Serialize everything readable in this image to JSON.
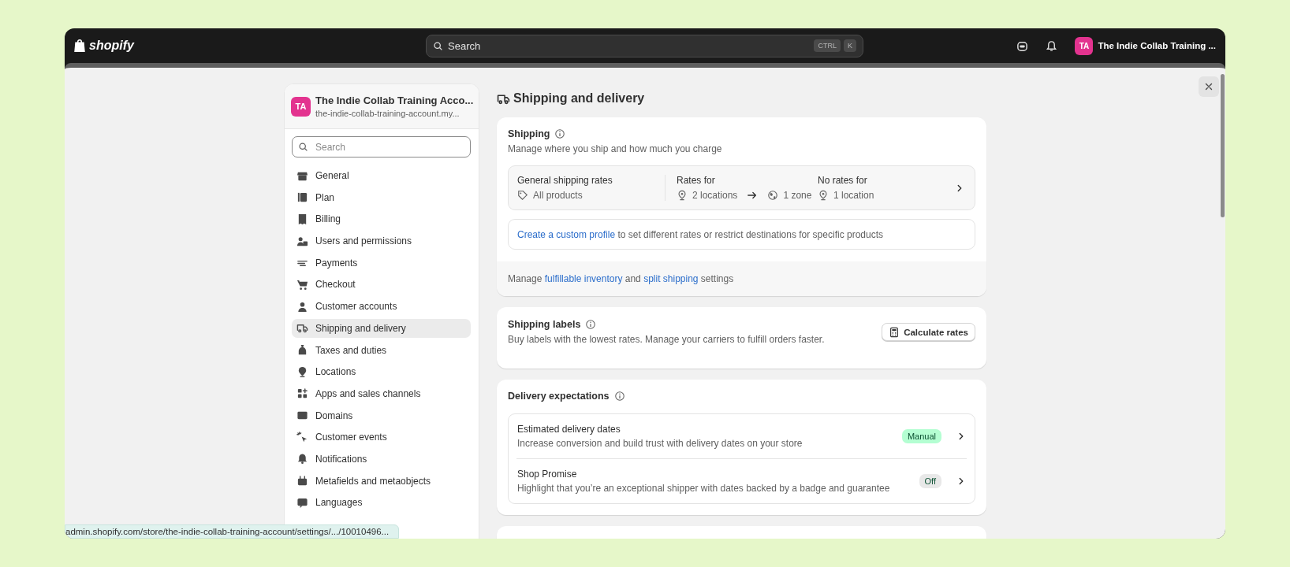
{
  "topbar": {
    "logo": "shopify",
    "search": {
      "placeholder": "Search",
      "shortcut": [
        "CTRL",
        "K"
      ]
    },
    "store": {
      "initials": "TA",
      "name": "The Indie Collab Training ..."
    }
  },
  "sidebar": {
    "store": {
      "initials": "TA",
      "name": "The Indie Collab Training Acco...",
      "domain": "the-indie-collab-training-account.my..."
    },
    "search": {
      "placeholder": "Search"
    },
    "items": [
      {
        "label": "General",
        "selected": false
      },
      {
        "label": "Plan",
        "selected": false
      },
      {
        "label": "Billing",
        "selected": false
      },
      {
        "label": "Users and permissions",
        "selected": false
      },
      {
        "label": "Payments",
        "selected": false
      },
      {
        "label": "Checkout",
        "selected": false
      },
      {
        "label": "Customer accounts",
        "selected": false
      },
      {
        "label": "Shipping and delivery",
        "selected": true
      },
      {
        "label": "Taxes and duties",
        "selected": false
      },
      {
        "label": "Locations",
        "selected": false
      },
      {
        "label": "Apps and sales channels",
        "selected": false
      },
      {
        "label": "Domains",
        "selected": false
      },
      {
        "label": "Customer events",
        "selected": false
      },
      {
        "label": "Notifications",
        "selected": false
      },
      {
        "label": "Metafields and metaobjects",
        "selected": false
      },
      {
        "label": "Languages",
        "selected": false
      }
    ]
  },
  "page": {
    "title": "Shipping and delivery"
  },
  "shipping": {
    "title": "Shipping",
    "description": "Manage where you ship and how much you charge",
    "profile": {
      "name": "General shipping rates",
      "products": "All products",
      "rates_label": "Rates for",
      "locations": "2 locations",
      "zones": "1 zone",
      "no_rates_label": "No rates for",
      "no_rates_locations": "1 location"
    },
    "custom_profile": [
      {
        "kind": "link",
        "text": "Create a custom profile"
      },
      {
        "kind": "text",
        "text": " to set different rates or restrict destinations for specific products"
      }
    ],
    "footer": [
      {
        "kind": "text",
        "text": "Manage "
      },
      {
        "kind": "link",
        "text": "fulfillable inventory"
      },
      {
        "kind": "text",
        "text": " and "
      },
      {
        "kind": "link",
        "text": "split shipping"
      },
      {
        "kind": "text",
        "text": " settings"
      }
    ]
  },
  "shipping_labels": {
    "title": "Shipping labels",
    "description": "Buy labels with the lowest rates. Manage your carriers to fulfill orders faster.",
    "button": "Calculate rates"
  },
  "delivery_expectations": {
    "title": "Delivery expectations",
    "items": [
      {
        "title": "Estimated delivery dates",
        "description": "Increase conversion and build trust with delivery dates on your store",
        "status": "Manual",
        "color": "#b4fed2"
      },
      {
        "title": "Shop Promise",
        "description": "Highlight that you’re an exceptional shipper with dates backed by a badge and guarantee",
        "status": "Off",
        "color": "#e8e8e8"
      }
    ]
  },
  "status_url": "admin.shopify.com/store/the-indie-collab-training-account/settings/.../10010496..."
}
